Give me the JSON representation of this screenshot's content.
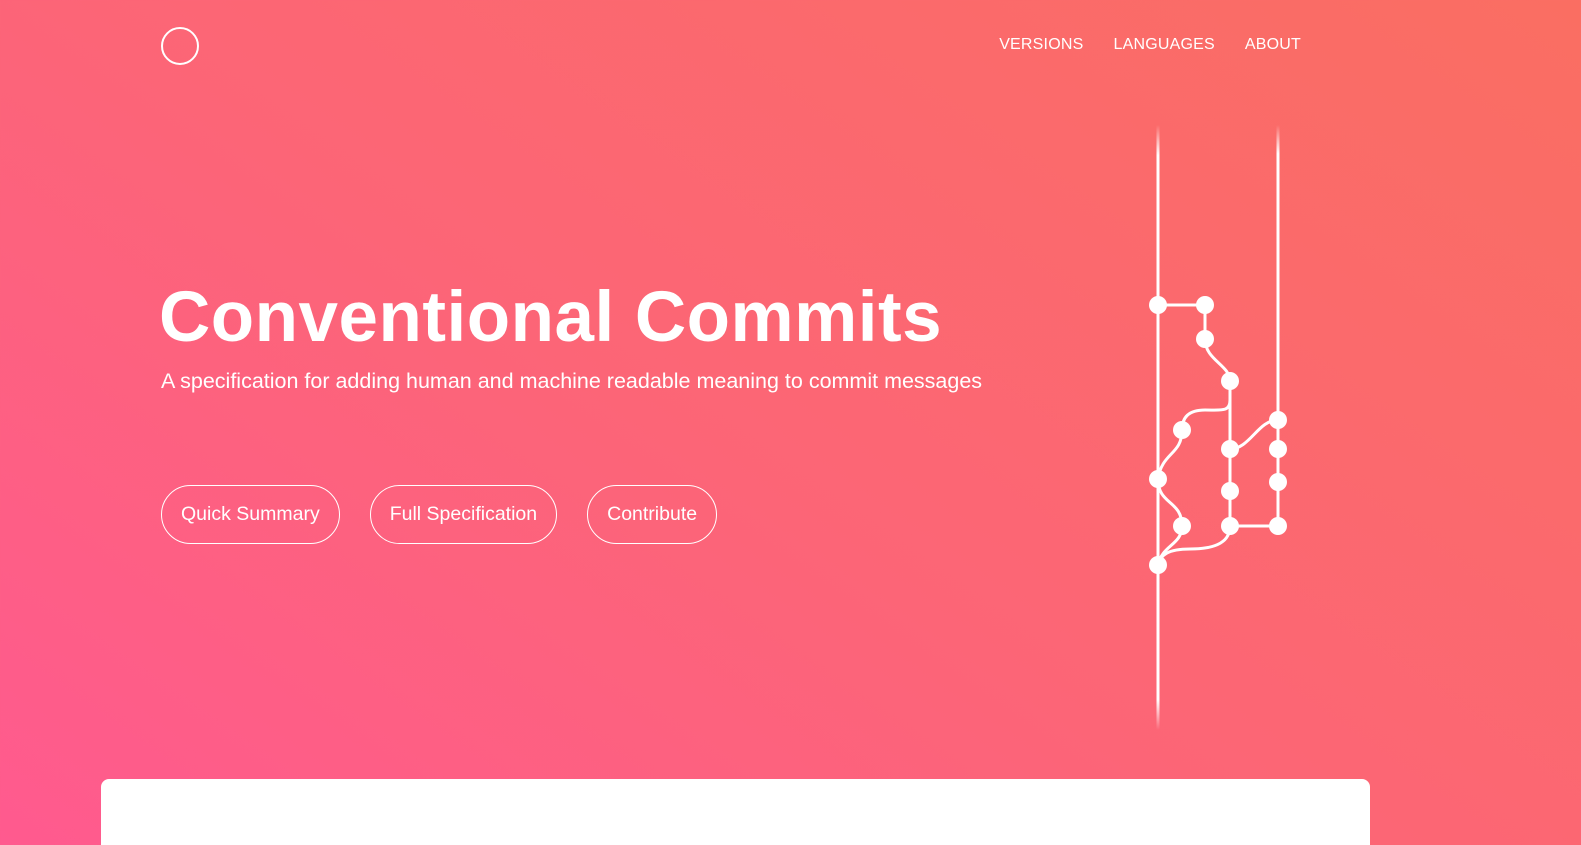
{
  "header": {
    "logo_icon": "circle-logo-icon",
    "nav": [
      {
        "label": "VERSIONS"
      },
      {
        "label": "LANGUAGES"
      },
      {
        "label": "ABOUT"
      }
    ]
  },
  "hero": {
    "title": "Conventional Commits",
    "subtitle": "A specification for adding human and machine readable meaning to commit messages",
    "buttons": [
      {
        "label": "Quick Summary"
      },
      {
        "label": "Full Specification"
      },
      {
        "label": "Contribute"
      }
    ],
    "illustration_icon": "git-branch-graph-icon"
  },
  "colors": {
    "gradient_start": "#ff5a8f",
    "gradient_mid": "#fc6577",
    "gradient_end": "#fa6e62",
    "foreground": "#ffffff",
    "card_background": "#ffffff"
  }
}
